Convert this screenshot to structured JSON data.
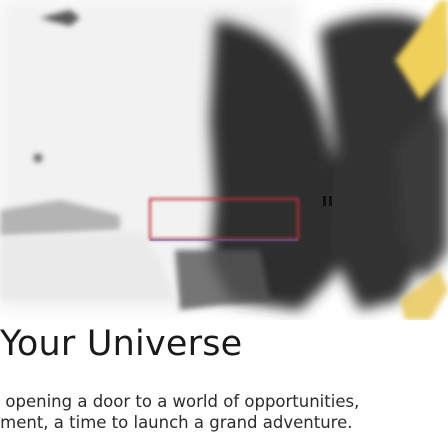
{
  "hero": {
    "image": "blurred-illustration",
    "colors": {
      "sky": "#f2f2f2",
      "dark": "#2e2e2e",
      "accent": "#f0d05a",
      "accent_outline": "#c0303a"
    }
  },
  "section": {
    "title": "Your Universe",
    "description_line_1": "e opening a door to a world of opportunities,",
    "description_line_2": "ement, a time to launch a grand adventure."
  }
}
